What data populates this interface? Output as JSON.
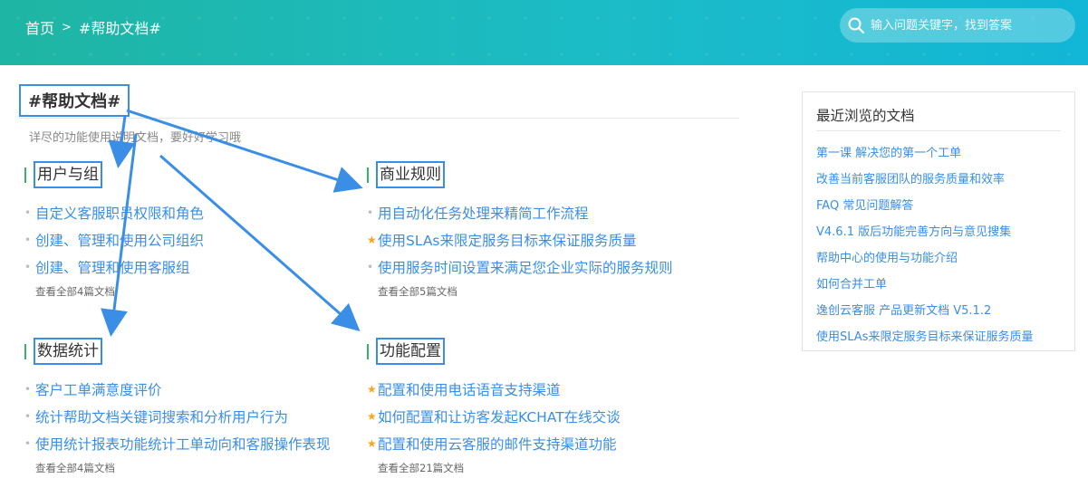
{
  "header": {
    "breadcrumb_home": "首页",
    "breadcrumb_sep": ">",
    "breadcrumb_current": "#帮助文档#",
    "search_placeholder": "输入问题关键字，找到答案"
  },
  "main": {
    "title": "#帮助文档#",
    "subtitle": "详尽的功能使用说明文档，要好好学习哦"
  },
  "sections": [
    {
      "title": "用户与组",
      "items": [
        {
          "label": "自定义客服职员权限和角色",
          "marker": "dot"
        },
        {
          "label": "创建、管理和使用公司组织",
          "marker": "dot"
        },
        {
          "label": "创建、管理和使用客服组",
          "marker": "dot"
        }
      ],
      "view_all": "查看全部4篇文档"
    },
    {
      "title": "商业规则",
      "items": [
        {
          "label": "用自动化任务处理来精简工作流程",
          "marker": "dot"
        },
        {
          "label": "使用SLAs来限定服务目标来保证服务质量",
          "marker": "star"
        },
        {
          "label": "使用服务时间设置来满足您企业实际的服务规则",
          "marker": "dot"
        }
      ],
      "view_all": "查看全部5篇文档"
    },
    {
      "title": "数据统计",
      "items": [
        {
          "label": "客户工单满意度评价",
          "marker": "dot"
        },
        {
          "label": "统计帮助文档关键词搜索和分析用户行为",
          "marker": "dot"
        },
        {
          "label": "使用统计报表功能统计工单动向和客服操作表现",
          "marker": "dot"
        }
      ],
      "view_all": "查看全部4篇文档"
    },
    {
      "title": "功能配置",
      "items": [
        {
          "label": "配置和使用电话语音支持渠道",
          "marker": "star"
        },
        {
          "label": "如何配置和让访客发起KCHAT在线交谈",
          "marker": "star"
        },
        {
          "label": "配置和使用云客服的邮件支持渠道功能",
          "marker": "star"
        }
      ],
      "view_all": "查看全部21篇文档"
    }
  ],
  "recent": {
    "title": "最近浏览的文档",
    "items": [
      "第一课 解决您的第一个工单",
      "改善当前客服团队的服务质量和效率",
      "FAQ 常见问题解答",
      "V4.6.1 版后功能完善方向与意见搜集",
      "帮助中心的使用与功能介绍",
      "如何合并工单",
      "逸创云客服 产品更新文档 V5.1.2",
      "使用SLAs来限定服务目标来保证服务质量"
    ]
  },
  "colors": {
    "accent": "#3a8ee6",
    "header_start": "#1fb5a3",
    "header_end": "#12b6d6",
    "section_bar": "#35b36b",
    "star": "#f5a623",
    "annotation": "#3a8ee6"
  }
}
